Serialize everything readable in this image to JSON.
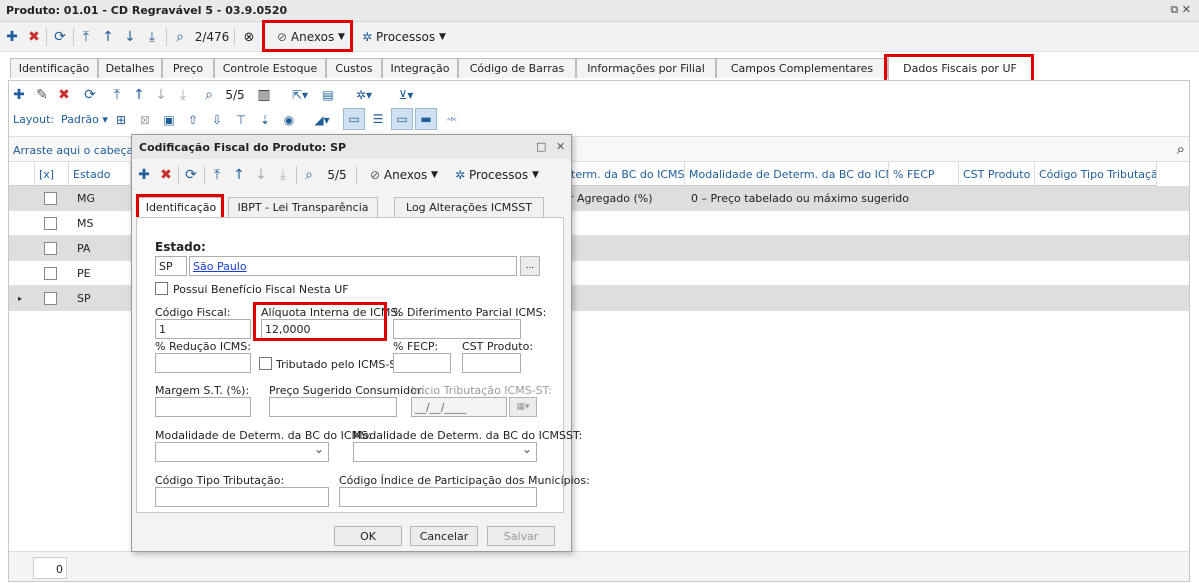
{
  "window": {
    "title": "Produto: 01.01 - CD Regravável 5 - 03.9.0520",
    "restore_icon": "restore-icon"
  },
  "toolbar": {
    "record_position": "2/476",
    "anexos_label": "Anexos",
    "processos_label": "Processos"
  },
  "tabs": [
    "Identificação",
    "Detalhes",
    "Preço",
    "Controle Estoque",
    "Custos",
    "Integração",
    "Código de Barras",
    "Informações por Filial",
    "Campos Complementares",
    "Dados Fiscais por UF"
  ],
  "grid_toolbar": {
    "record_position": "5/5",
    "layout_label": "Layout:",
    "layout_value": "Padrão"
  },
  "grid": {
    "group_hint": "Arraste aqui o cabeçalho d",
    "headers": {
      "select_all": "[x]",
      "estado": "Estado",
      "modalidade_bc": "term. da BC do ICMS",
      "modalidade_bcst": "Modalidade de Determ. da BC do ICMSST",
      "fecp": "% FECP",
      "cst": "CST Produto",
      "codigo_tributacao": "Código Tipo Tributação"
    },
    "rows": [
      {
        "estado": "MG",
        "bc_icms": "r Agregado (%)",
        "bc_icmsst": "0 – Preço tabelado ou máximo sugerido"
      },
      {
        "estado": "MS",
        "bc_icms": "",
        "bc_icmsst": ""
      },
      {
        "estado": "PA",
        "bc_icms": "",
        "bc_icmsst": ""
      },
      {
        "estado": "PE",
        "bc_icms": "",
        "bc_icmsst": ""
      },
      {
        "estado": "SP",
        "bc_icms": "",
        "bc_icmsst": ""
      }
    ],
    "footer_count": "0"
  },
  "dialog": {
    "title": "Codificação Fiscal do Produto: SP",
    "record_position": "5/5",
    "anexos_label": "Anexos",
    "processos_label": "Processos",
    "tabs": [
      "Identificação",
      "IBPT - Lei Transparência",
      "Log Alterações ICMSST"
    ],
    "estado_label": "Estado:",
    "estado_code": "SP",
    "estado_name": "São Paulo",
    "lookup_label": "...",
    "beneficio_label": "Possui Benefício Fiscal Nesta UF",
    "codigo_fiscal_label": "Código Fiscal:",
    "codigo_fiscal_value": "1",
    "aliquota_label": "Alíquota Interna de ICMS:",
    "aliquota_value": "12,0000",
    "diferimento_label": "% Diferimento Parcial ICMS:",
    "reducao_label": "% Redução ICMS:",
    "tributado_label": "Tributado pelo ICMS-ST",
    "fecp_label": "% FECP:",
    "cst_label": "CST Produto:",
    "margem_label": "Margem S.T. (%):",
    "preco_sugerido_label": "Preço Sugerido Consumidor:",
    "inicio_tributacao_label": "Início Tributação ICMS-ST:",
    "inicio_tributacao_placeholder": "__/__/____",
    "modalidade_icms_label": "Modalidade de Determ. da BC do ICMS:",
    "modalidade_icmsst_label": "Modalidade de Determ. da BC do ICMSST:",
    "codigo_tipo_label": "Código Tipo Tributação:",
    "codigo_indice_label": "Código Índice de Participação dos Municípios:",
    "ok_label": "OK",
    "cancelar_label": "Cancelar",
    "salvar_label": "Salvar"
  },
  "colors": {
    "highlight": "#e00000",
    "accent": "#1f5e9a",
    "delete": "#c9302c"
  }
}
